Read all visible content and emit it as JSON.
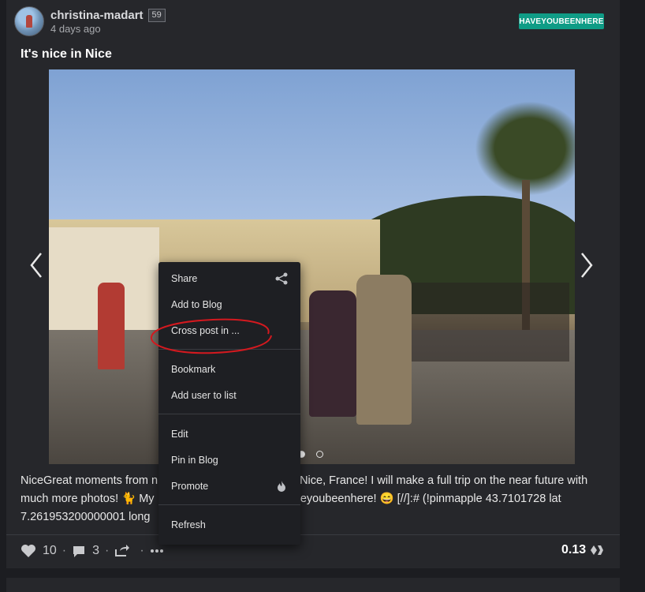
{
  "post": {
    "author": "christina-madart",
    "reputation": "59",
    "date": "4 days ago",
    "tag": "HAVEYOUBEENHERE",
    "title": "It's nice in Nice",
    "body_line1": "NiceGreat moments from n",
    "body_line1b": "Nice, France! I will make a full trip on the near future with",
    "body_line2a": "much more photos! 🐈 My",
    "body_line2b": "veyoubeenhere! 😄 [//]:# (!pinmapple 43.7101728 lat",
    "body_line3": "7.261953200000001 long"
  },
  "footer": {
    "votes": "10",
    "comments": "3",
    "payout": "0.13"
  },
  "menu": {
    "items": [
      {
        "label": "Share"
      },
      {
        "label": "Add to Blog"
      },
      {
        "label": "Cross post in ..."
      },
      {
        "label": "Bookmark"
      },
      {
        "label": "Add user to list"
      },
      {
        "label": "Edit"
      },
      {
        "label": "Pin in Blog"
      },
      {
        "label": "Promote"
      },
      {
        "label": "Refresh"
      }
    ]
  },
  "colors": {
    "tag_bg": "#0f9c86",
    "annotation": "#d3191f",
    "card_bg": "#26272b"
  },
  "icons": {
    "share": "share-icon",
    "promote": "flame-icon",
    "like": "heart-icon",
    "comment": "comment-icon",
    "reblog": "reblog-icon",
    "more": "more-icon",
    "currency": "hive-icon"
  }
}
